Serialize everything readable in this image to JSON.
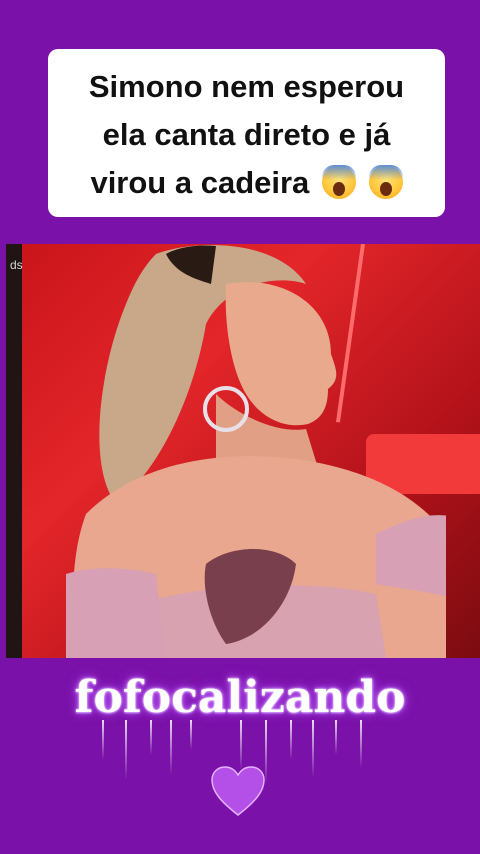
{
  "caption": {
    "line1": "Simono nem esperou",
    "line2": "ela canta direto e já",
    "line3": "virou a cadeira",
    "emoji_1": "face-screaming-in-fear-icon",
    "emoji_2": "face-screaming-in-fear-icon"
  },
  "video": {
    "corner_mark": "ds",
    "background_color": "#d21d22"
  },
  "brand": {
    "name": "fofocalizando",
    "heart_icon": "purple-heart-icon",
    "heart_color": "#b44fe8"
  },
  "theme": {
    "background": "#7a11a8"
  }
}
